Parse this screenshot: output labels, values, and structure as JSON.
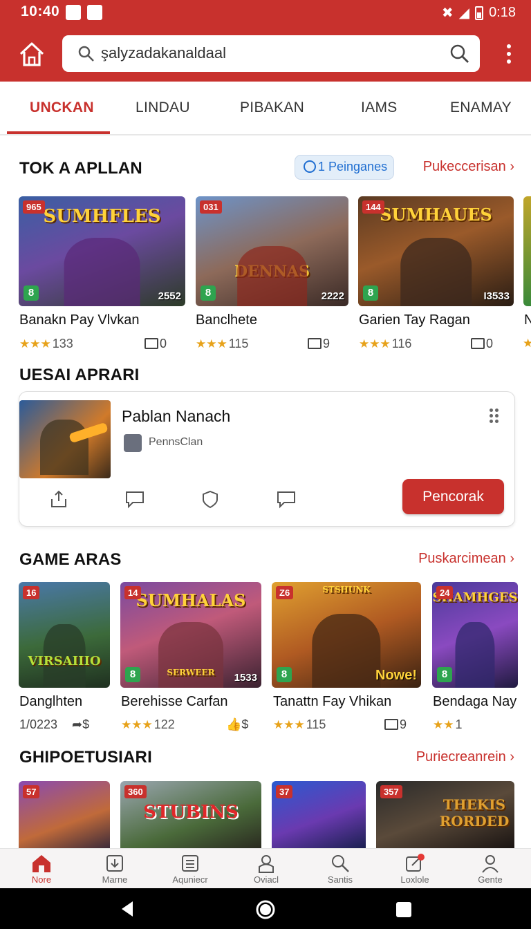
{
  "status": {
    "time": "10:40",
    "right_text": "0:18"
  },
  "search": {
    "query": "şalyzadakanaldaal"
  },
  "tabs": [
    "UNCKAN",
    "LINDAU",
    "PIBAKAN",
    "IAMS",
    "ENAMAY"
  ],
  "section1": {
    "title": "TOK A APLLAN",
    "pill": "1 Peinganes",
    "see_more": "Pukeccerisan ›",
    "cards": [
      {
        "num": "965",
        "art": "SUMHFLES",
        "corner": "2552",
        "name": "Banakn Pay Vlvkan",
        "stars": "★★★",
        "rating": "133",
        "extra": "0"
      },
      {
        "num": "031",
        "art": "DENNAS",
        "corner": "2222",
        "name": "Banclhete",
        "stars": "★★★",
        "rating": "115",
        "extra": "9"
      },
      {
        "num": "144",
        "art": "SUMHAUES",
        "corner": "I3533",
        "name": "Garien Tay Ragan",
        "stars": "★★★",
        "rating": "116",
        "extra": "0"
      },
      {
        "name": "N"
      }
    ]
  },
  "section2": {
    "title": "UESAI APRARI",
    "name": "Pablan Nanach",
    "developer": "PennsClan",
    "button": "Pencorak"
  },
  "section3": {
    "title": "GAME ARAS",
    "see_more": "Puskarcimean ›",
    "cards": [
      {
        "num": "16",
        "art": "VIRSAIIIO",
        "name": "Danglhten",
        "meta": "1/0223",
        "extra": "$"
      },
      {
        "num": "14",
        "art": "SUMHALAS",
        "sub": "SERWEER",
        "corner": "1533",
        "name": "Berehisse Carfan",
        "stars": "★★★",
        "rating": "122",
        "extra": "$"
      },
      {
        "num": "Z6",
        "art": "STSHUNK",
        "corner": "Nowe!",
        "name": "Tanattn Fay Vhikan",
        "stars": "★★★",
        "rating": "115",
        "extra": "9"
      },
      {
        "num": "24",
        "art": "SHAMHGES",
        "name": "Bendaga Nay",
        "stars": "★★",
        "rating": "1"
      }
    ]
  },
  "section4": {
    "title": "GHIPOETUSIARI",
    "see_more": "Puriecreanrein ›",
    "cards": [
      {
        "num": "57"
      },
      {
        "num": "360",
        "art": "STUBINS"
      },
      {
        "num": "37"
      },
      {
        "num": "357",
        "art": "THEKIS RORDED"
      }
    ]
  },
  "bottom_nav": [
    "Nore",
    "Marne",
    "Aquniecr",
    "Oviacl",
    "Santis",
    "Loxlole",
    "Gente"
  ],
  "colors": {
    "brand": "#c8312d",
    "link": "#1f6ed1",
    "star": "#e7a21a"
  }
}
